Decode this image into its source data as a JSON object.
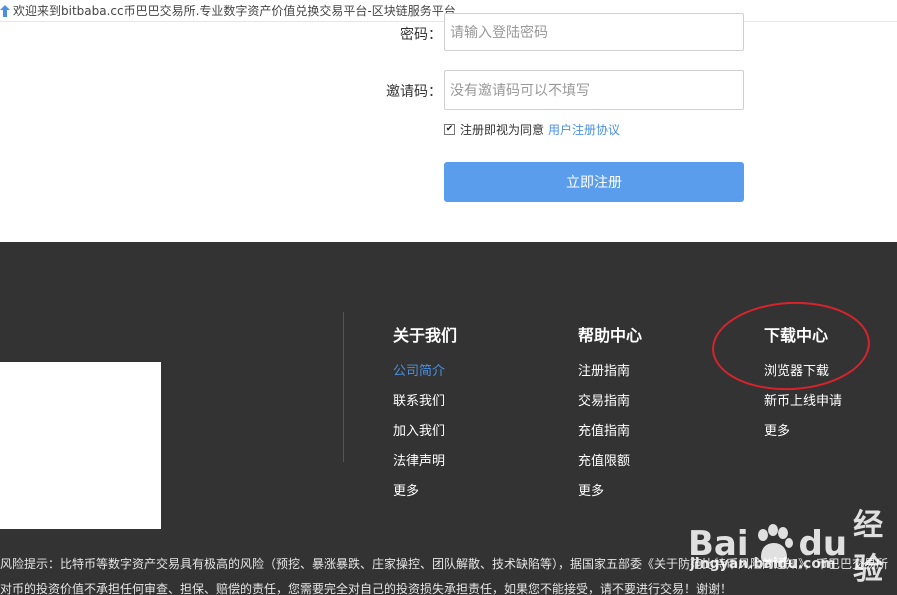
{
  "window": {
    "title": "欢迎来到bitbaba.cc币巴巴交易所.专业数字资产价值兑换交易平台-区块链服务平台"
  },
  "form": {
    "password_label": "密码：",
    "password_placeholder": "请输入登陆密码",
    "invite_label": "邀请码：",
    "invite_placeholder": "没有邀请码可以不填写",
    "agree_checked": true,
    "agree_text": "注册即视为同意",
    "agree_link": "用户注册协议",
    "submit_label": "立即注册"
  },
  "footer": {
    "columns": [
      {
        "title": "关于我们",
        "links": [
          "公司简介",
          "联系我们",
          "加入我们",
          "法律声明",
          "更多"
        ]
      },
      {
        "title": "帮助中心",
        "links": [
          "注册指南",
          "交易指南",
          "充值指南",
          "充值限额",
          "更多"
        ]
      },
      {
        "title": "下载中心",
        "links": [
          "浏览器下载",
          "新币上线申请",
          "更多"
        ]
      }
    ],
    "risk_line_1": "风险提示：比特币等数字资产交易具有极高的风险（预挖、暴涨暴跌、庄家操控、团队解散、技术缺陷等），据国家五部委《关于防范比特币风险的通知》，币巴巴交易所",
    "risk_line_2": "对币的投资价值不承担任何审查、担保、赔偿的责任，您需要完全对自己的投资损失承担责任，如果您不能接受，请不要进行交易！谢谢！"
  },
  "watermark": {
    "brand_bai": "Bai",
    "brand_du": "du",
    "brand_cn": "经验",
    "url": "jingyan.baidu.com"
  },
  "colors": {
    "accent": "#4a90e2",
    "button": "#5b9ded",
    "footer_bg": "#333333",
    "highlight_circle": "#d9232b"
  }
}
